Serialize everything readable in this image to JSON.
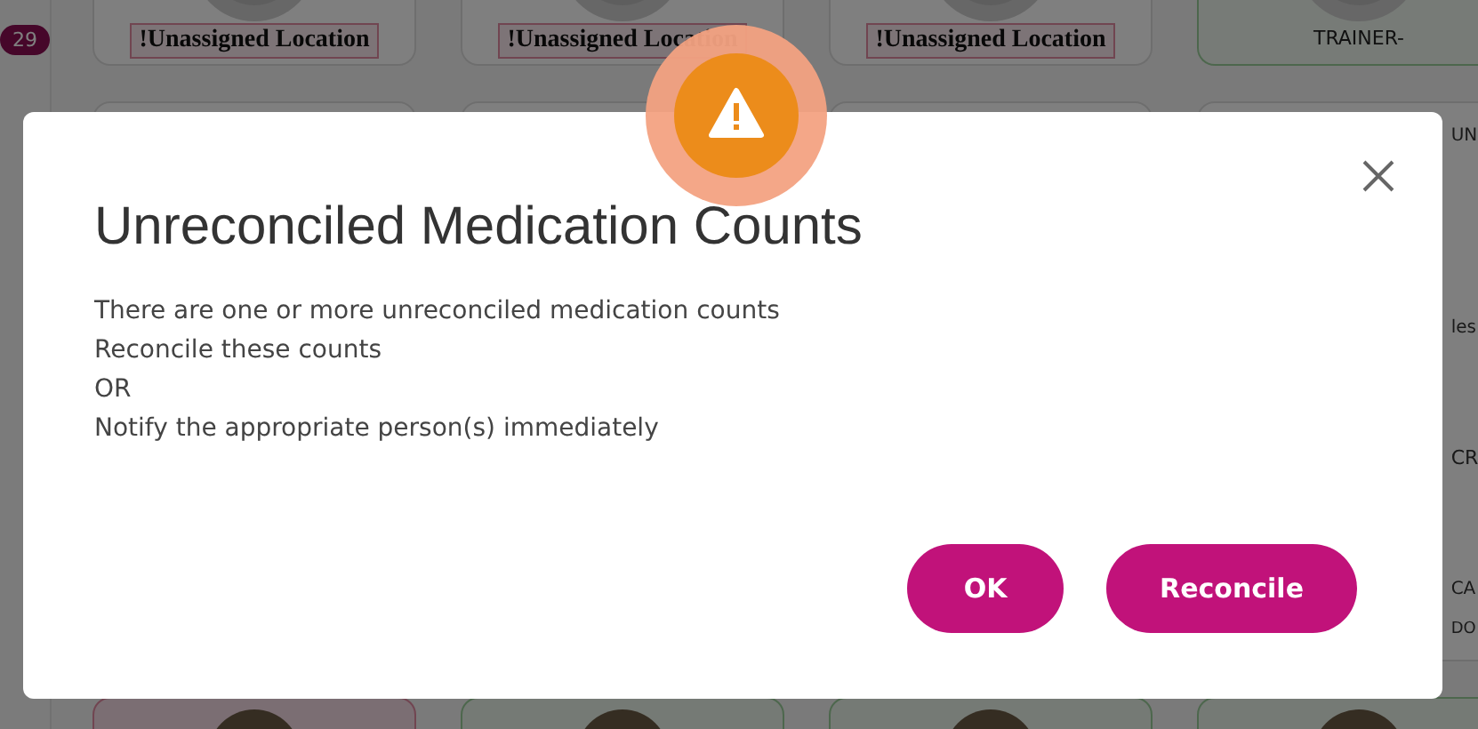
{
  "background": {
    "badge": "29",
    "top_cards": [
      {
        "label": "!Unassigned Location"
      },
      {
        "label": "!Unassigned Location"
      },
      {
        "label": "!Unassigned Location"
      }
    ],
    "trainer_label": "TRAINER-",
    "edge_texts": [
      "UN",
      "les",
      "CR",
      "CA",
      "DO"
    ]
  },
  "dialog": {
    "title": "Unreconciled Medication Counts",
    "lines": [
      "There are one or more unreconciled medication counts",
      "Reconcile these counts",
      "OR",
      "Notify the appropriate person(s) immediately"
    ],
    "buttons": [
      {
        "label": "OK",
        "kind": "primary"
      },
      {
        "label": "Reconcile",
        "kind": "primary"
      }
    ]
  }
}
